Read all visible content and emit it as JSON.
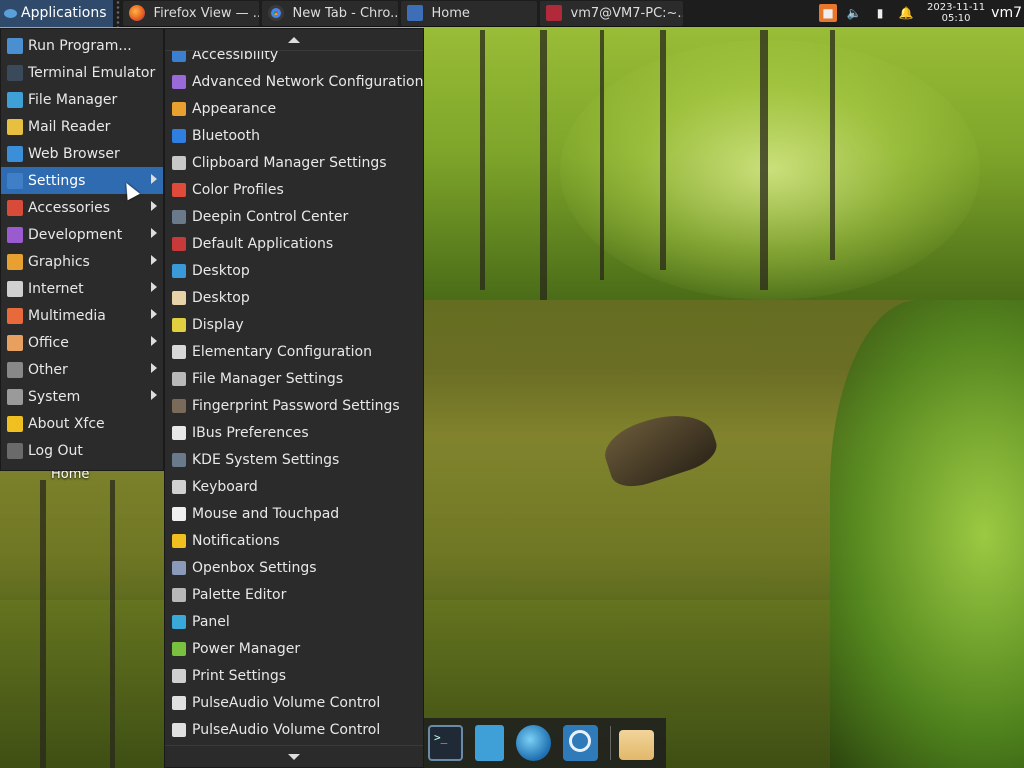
{
  "top_panel": {
    "applications_label": "Applications",
    "tasks": [
      {
        "label": "Firefox View — ...",
        "kind": "ff"
      },
      {
        "label": "New Tab - Chro...",
        "kind": "chrome"
      },
      {
        "label": "Home",
        "kind": "home"
      },
      {
        "label": "vm7@VM7-PC:~...",
        "kind": "term"
      }
    ],
    "clock_date": "2023-11-11",
    "clock_time": "05:10",
    "user": "vm7"
  },
  "desktop": {
    "icon_label": "Home"
  },
  "main_menu": {
    "items": [
      {
        "label": "Run Program...",
        "icon": "run-icon",
        "color": "#4a8fd0"
      },
      {
        "label": "Terminal Emulator",
        "icon": "terminal-icon",
        "color": "#3a4a5a"
      },
      {
        "label": "File Manager",
        "icon": "file-manager-icon",
        "color": "#3fa0d8"
      },
      {
        "label": "Mail Reader",
        "icon": "mail-icon",
        "color": "#e8c040"
      },
      {
        "label": "Web Browser",
        "icon": "web-browser-icon",
        "color": "#3a8fd8"
      },
      {
        "label": "Settings",
        "icon": "settings-icon",
        "color": "#3f7fc8",
        "submenu": true
      },
      {
        "label": "Accessories",
        "icon": "accessories-icon",
        "color": "#d84a3a",
        "submenu": true
      },
      {
        "label": "Development",
        "icon": "development-icon",
        "color": "#9a5ad0",
        "submenu": true
      },
      {
        "label": "Graphics",
        "icon": "graphics-icon",
        "color": "#e8a030",
        "submenu": true
      },
      {
        "label": "Internet",
        "icon": "internet-icon",
        "color": "#d0d0d0",
        "submenu": true
      },
      {
        "label": "Multimedia",
        "icon": "multimedia-icon",
        "color": "#e86a3a",
        "submenu": true
      },
      {
        "label": "Office",
        "icon": "office-icon",
        "color": "#e8a060",
        "submenu": true
      },
      {
        "label": "Other",
        "icon": "other-icon",
        "color": "#888888",
        "submenu": true
      },
      {
        "label": "System",
        "icon": "system-icon",
        "color": "#9a9a9a",
        "submenu": true
      },
      {
        "label": "About Xfce",
        "icon": "star-icon",
        "color": "#f0c020"
      },
      {
        "label": "Log Out",
        "icon": "log-out-icon",
        "color": "#6a6a6a"
      }
    ],
    "active_index": 5
  },
  "settings_menu": {
    "items": [
      {
        "label": "Accessibility",
        "color": "#3a7fd0"
      },
      {
        "label": "Advanced Network Configuration",
        "color": "#9a6ad8"
      },
      {
        "label": "Appearance",
        "color": "#e8a030"
      },
      {
        "label": "Bluetooth",
        "color": "#2f7fe0"
      },
      {
        "label": "Clipboard Manager Settings",
        "color": "#c8c8c8"
      },
      {
        "label": "Color Profiles",
        "color": "#e04a3a"
      },
      {
        "label": "Deepin Control Center",
        "color": "#6a7a8a"
      },
      {
        "label": "Default Applications",
        "color": "#c83a3a"
      },
      {
        "label": "Desktop",
        "color": "#3a9ad8"
      },
      {
        "label": "Desktop",
        "color": "#e8d2a8"
      },
      {
        "label": "Display",
        "color": "#e0d040"
      },
      {
        "label": "Elementary Configuration",
        "color": "#d8d8d8"
      },
      {
        "label": "File Manager Settings",
        "color": "#b8b8b8"
      },
      {
        "label": "Fingerprint Password Settings",
        "color": "#7a6a5a"
      },
      {
        "label": "IBus Preferences",
        "color": "#e8e8e8"
      },
      {
        "label": "KDE System Settings",
        "color": "#6a7a8a"
      },
      {
        "label": "Keyboard",
        "color": "#d0d0d0"
      },
      {
        "label": "Mouse and Touchpad",
        "color": "#f0f0f0"
      },
      {
        "label": "Notifications",
        "color": "#f0c020"
      },
      {
        "label": "Openbox Settings",
        "color": "#8a9ab8"
      },
      {
        "label": "Palette Editor",
        "color": "#b8b8b8"
      },
      {
        "label": "Panel",
        "color": "#3aa8d8"
      },
      {
        "label": "Power Manager",
        "color": "#7ac040"
      },
      {
        "label": "Print Settings",
        "color": "#d0d0d0"
      },
      {
        "label": "PulseAudio Volume Control",
        "color": "#e0e0e0"
      },
      {
        "label": "PulseAudio Volume Control",
        "color": "#e0e0e0"
      }
    ]
  },
  "dock": {
    "items": [
      {
        "name": "terminal-dock-icon"
      },
      {
        "name": "file-manager-dock-icon"
      },
      {
        "name": "web-browser-dock-icon"
      },
      {
        "name": "app-finder-dock-icon"
      },
      {
        "name": "folder-dock-icon"
      }
    ]
  },
  "colors": {
    "panel_bg": "#1d1d1d",
    "menu_bg": "#2b2b2b",
    "accent": "#2f6bb0"
  }
}
